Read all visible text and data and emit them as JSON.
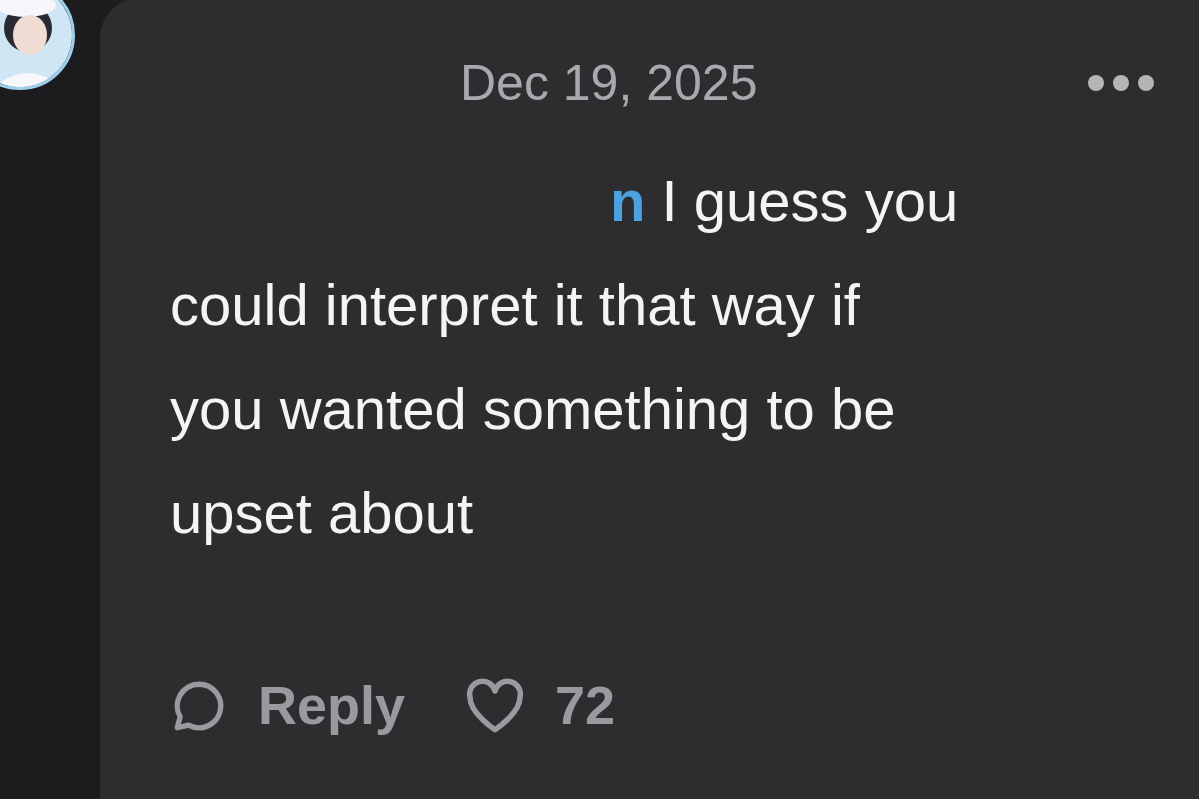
{
  "comment": {
    "date": "Dec 19, 2025",
    "mention": "n",
    "lines": [
      "I guess you",
      "could interpret it that way if",
      "you wanted something to be",
      "upset about"
    ]
  },
  "actions": {
    "reply_label": "Reply",
    "like_count": "72",
    "liked": false
  }
}
